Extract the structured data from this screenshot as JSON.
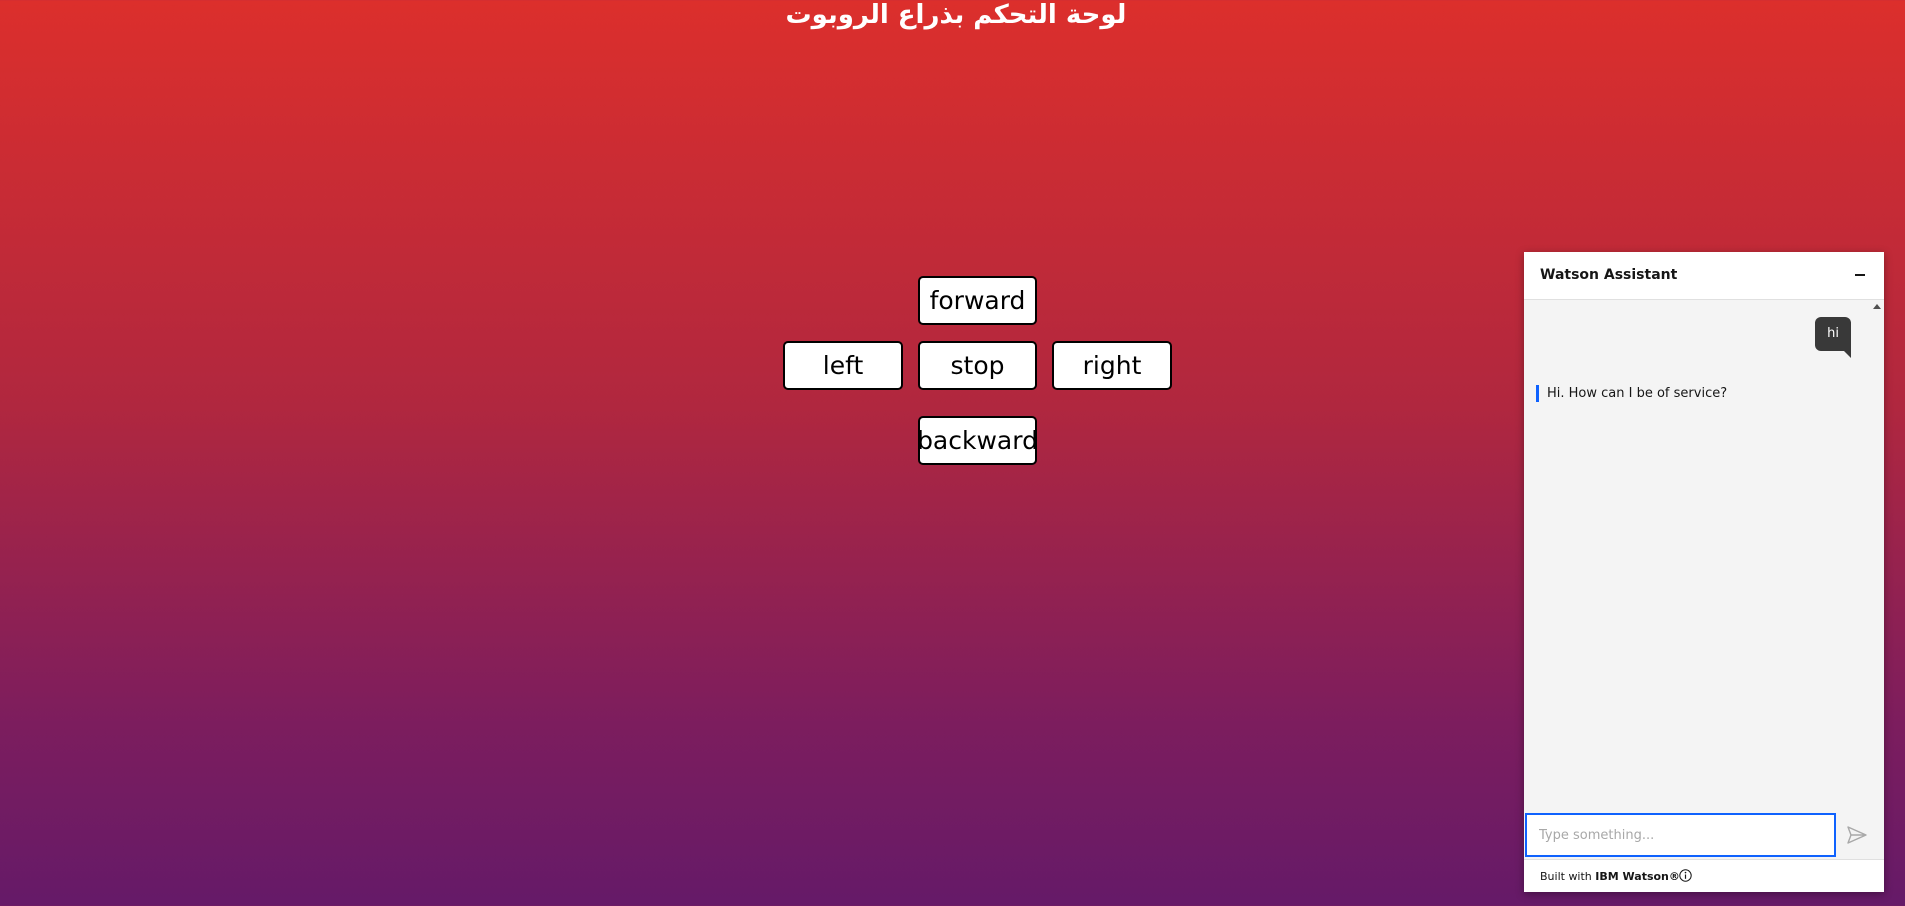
{
  "page": {
    "title": "لوحة التحكم بذراع الروبوت"
  },
  "controls": {
    "forward": "forward",
    "left": "left",
    "stop": "stop",
    "right": "right",
    "backward": "backward"
  },
  "assistant": {
    "title": "Watson Assistant",
    "messages": [
      {
        "from": "user",
        "text": "hi"
      },
      {
        "from": "bot",
        "text": "Hi. How can I be of service?"
      }
    ],
    "help_label": "?",
    "input_placeholder": "Type something...",
    "input_value": "",
    "footer_prefix": "Built with ",
    "footer_brand": "IBM Watson®",
    "accent_color": "#0f62fe",
    "icons": {
      "minimize": "minimize-icon",
      "send": "send-icon",
      "info": "info-icon",
      "help": "help-icon"
    }
  },
  "colors": {
    "background_top": "#dc2f2c",
    "background_bottom": "#651a68"
  }
}
